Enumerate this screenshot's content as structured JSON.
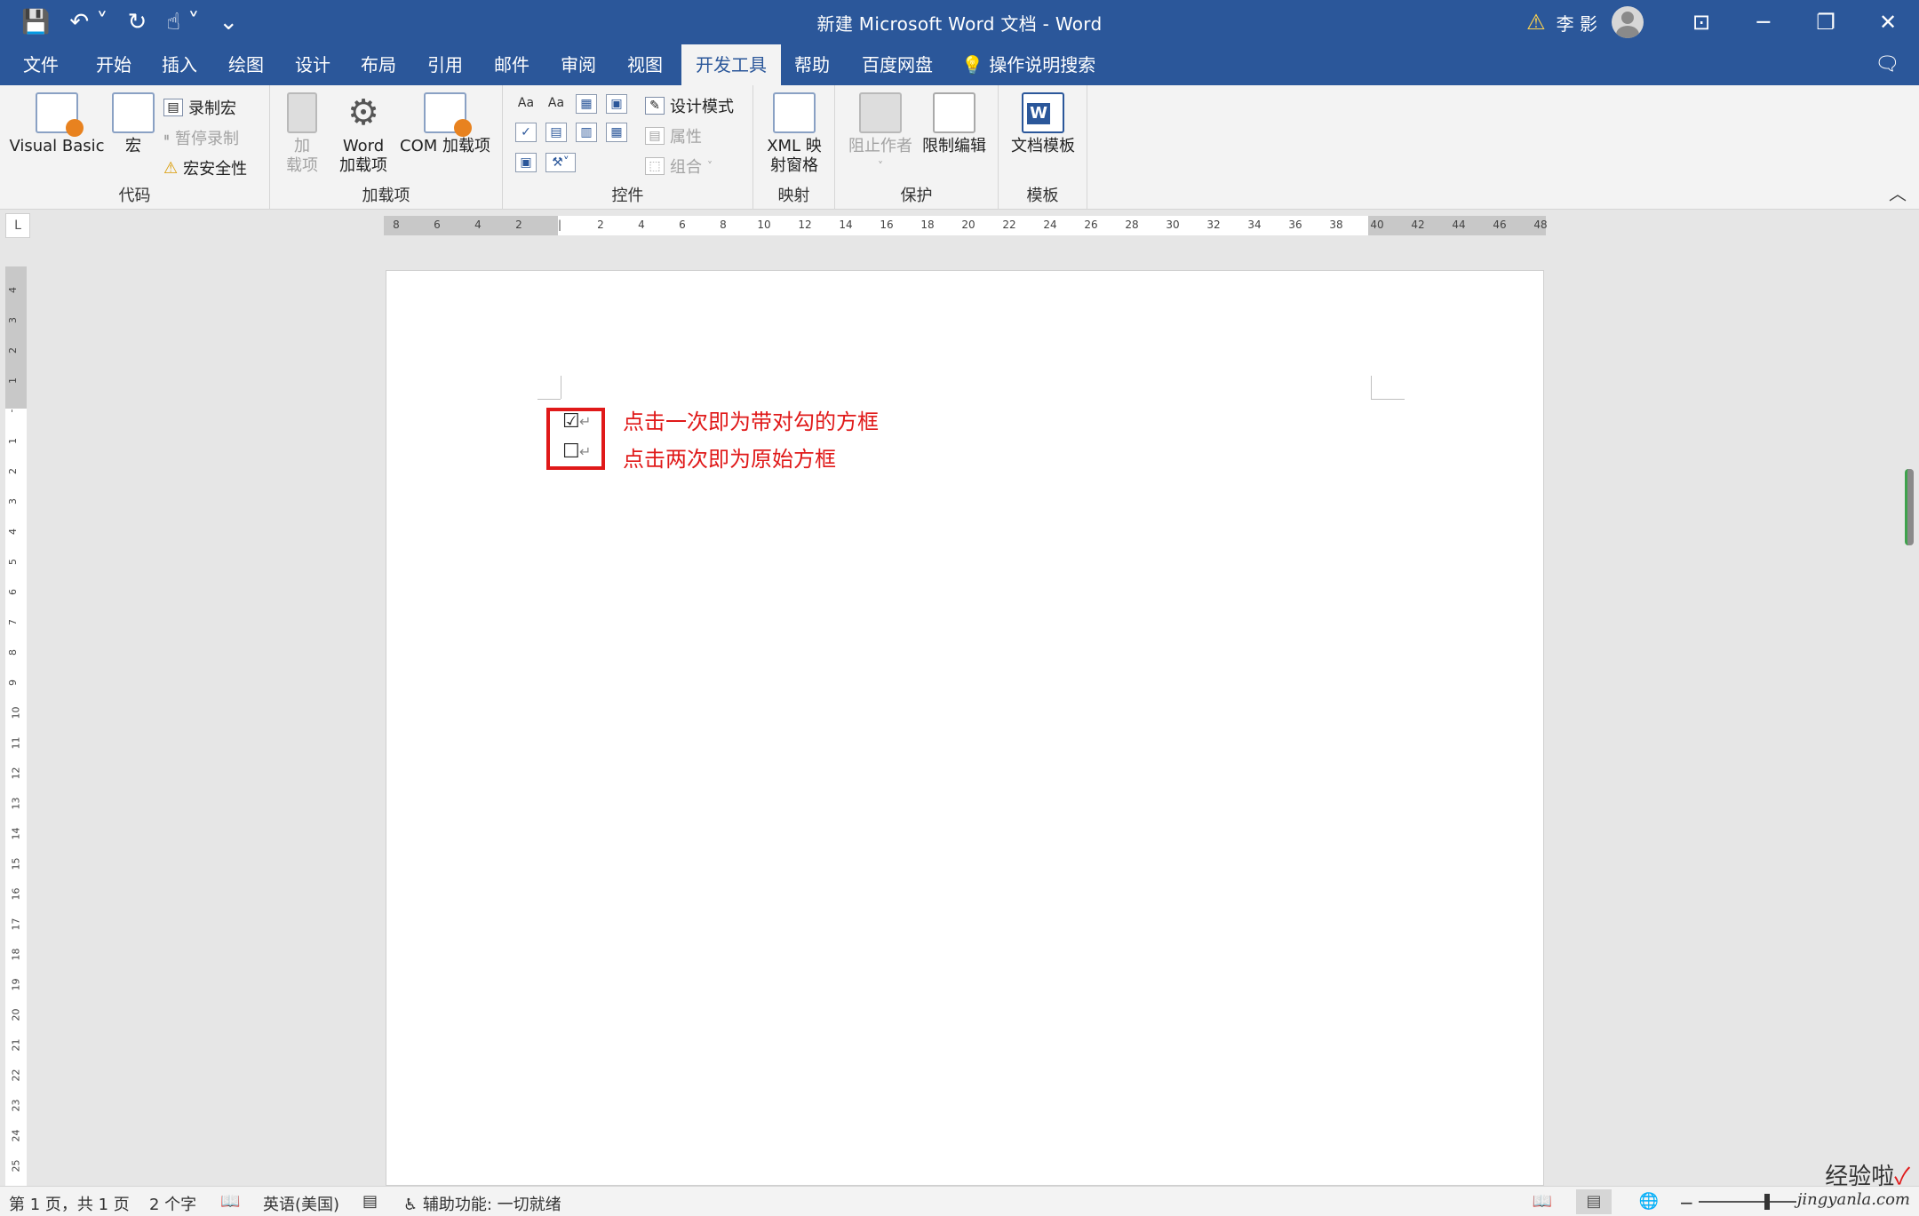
{
  "titlebar": {
    "title": "新建 Microsoft Word 文档  -  Word",
    "user": "李 影",
    "qat_icons": [
      "save-icon",
      "undo-icon",
      "redo-icon",
      "touch-mode-icon",
      "customize-qat-icon"
    ]
  },
  "tabs": [
    {
      "label": "文件"
    },
    {
      "label": "开始"
    },
    {
      "label": "插入"
    },
    {
      "label": "绘图"
    },
    {
      "label": "设计"
    },
    {
      "label": "布局"
    },
    {
      "label": "引用"
    },
    {
      "label": "邮件"
    },
    {
      "label": "审阅"
    },
    {
      "label": "视图"
    },
    {
      "label": "开发工具",
      "active": true
    },
    {
      "label": "帮助"
    },
    {
      "label": "百度网盘"
    }
  ],
  "search_label": "操作说明搜索",
  "ribbon": {
    "code": {
      "label": "代码",
      "visual_basic": "Visual Basic",
      "macro": "宏",
      "record_macro": "录制宏",
      "pause_record": "暂停录制",
      "macro_security": "宏安全性"
    },
    "addins": {
      "label": "加载项",
      "addin_line1": "加",
      "addin_line2": "载项",
      "word_addin_line1": "Word",
      "word_addin_line2": "加载项",
      "com_addin": "COM 加载项"
    },
    "controls": {
      "label": "控件",
      "design_mode": "设计模式",
      "properties": "属性",
      "group": "组合"
    },
    "mapping": {
      "label": "映射",
      "xml_line1": "XML 映",
      "xml_line2": "射窗格"
    },
    "protect": {
      "label": "保护",
      "block_authors": "阻止作者",
      "restrict_editing": "限制编辑"
    },
    "templates": {
      "label": "模板",
      "doc_template": "文档模板"
    }
  },
  "ruler": {
    "h_labels": [
      "8",
      "6",
      "4",
      "2",
      "",
      "2",
      "4",
      "6",
      "8",
      "10",
      "12",
      "14",
      "16",
      "18",
      "20",
      "22",
      "24",
      "26",
      "28",
      "30",
      "32",
      "34",
      "36",
      "38",
      "40",
      "42",
      "44",
      "46",
      "48"
    ],
    "v_labels": [
      "4",
      "3",
      "2",
      "1",
      "",
      "1",
      "2",
      "3",
      "4",
      "5",
      "6",
      "7",
      "8",
      "9",
      "10",
      "11",
      "12",
      "13",
      "14",
      "15",
      "16",
      "17",
      "18",
      "19",
      "20",
      "21",
      "22",
      "23",
      "24",
      "25"
    ]
  },
  "document": {
    "checkbox_checked": "☑",
    "checkbox_unchecked": "☐",
    "para_mark": "↵",
    "annotation_1": "点击一次即为带对勾的方框",
    "annotation_2": "点击两次即为原始方框"
  },
  "status": {
    "page": "第 1 页，共 1 页",
    "words": "2 个字",
    "language": "英语(美国)",
    "accessibility": "辅助功能: 一切就绪"
  },
  "watermark": {
    "line1": "经验啦",
    "tick": "✓",
    "line2": "jingyanla.com"
  }
}
